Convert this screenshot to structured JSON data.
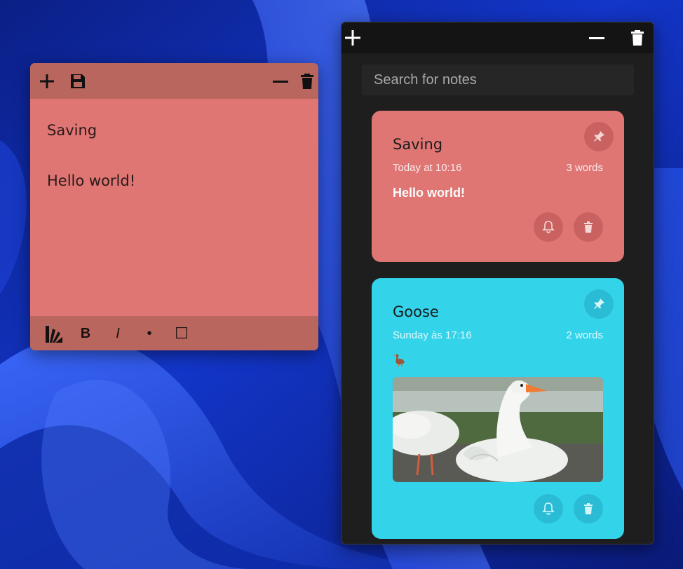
{
  "note_editor": {
    "lines": [
      "Saving",
      "Hello world!"
    ],
    "toolbar": {
      "bold_label": "B",
      "italic_label": "I",
      "bullet_label": "•",
      "checkbox_label": "☐"
    }
  },
  "notes_list": {
    "search": {
      "placeholder": "Search for notes",
      "value": ""
    },
    "notes": [
      {
        "title": "Saving",
        "date": "Today at 10:16",
        "words": "3 words",
        "content": "Hello world!",
        "color": "#df7673"
      },
      {
        "title": "Goose",
        "date": "Sunday às 17:16",
        "words": "2 words",
        "content": "",
        "color": "#33d3ea"
      }
    ]
  },
  "icons": {
    "note_window": [
      "plus-icon",
      "save-icon",
      "minimize-icon",
      "trash-icon"
    ],
    "note_toolbar": [
      "color-palette-icon",
      "bold-icon",
      "italic-icon",
      "bullet-icon",
      "checkbox-icon"
    ],
    "list_window": [
      "plus-icon",
      "minimize-icon",
      "trash-icon"
    ],
    "card": [
      "pin-icon",
      "bell-icon",
      "trash-icon"
    ],
    "goose_note": [
      "goose-emoji-icon"
    ]
  }
}
